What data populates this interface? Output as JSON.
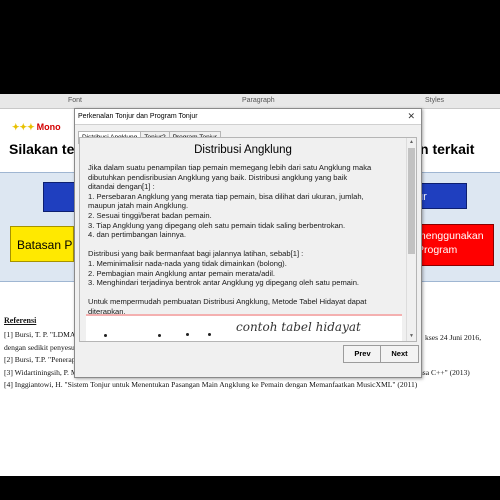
{
  "ribbon": {
    "groups": [
      "Font",
      "Paragraph",
      "Styles"
    ]
  },
  "document": {
    "logo_text": "Mono",
    "heading_left": "Silakan te",
    "heading_right": "n terkait",
    "btn_blue_right": "ur",
    "btn_yellow": "Batasan Pr",
    "btn_red_line1": "menggunakan",
    "btn_red_line2": "Program",
    "references": {
      "title": "Referensi",
      "items": [
        "[1] Bursi, T. P. \"LDMA",
        "dengan sedikit penyesu",
        "[2] Bursi, T.P. \"Penerap",
        "[3] Widartiningsih, P. M. \"Pendistribusian Angklung dan Komputasi Tonjur dengan Metode Pembagian Sesuai Beban menggunakan Bahasa C++\" (2013)",
        "[4] Inggiantowi, H. \"Sistem Tonjur untuk Menentukan Pasangan Main Angklung ke Pemain dengan Memanfaatkan MusicXML\" (2011)"
      ],
      "item1_tail": "kses 24 Juni 2016,"
    }
  },
  "dialog": {
    "title": "Perkenalan Tonjur dan Program Tonjur",
    "close_label": "✕",
    "tabs": [
      "Distribusi Angklung",
      "Tonjur?",
      "Program Tonjur"
    ],
    "active_tab": "Distribusi Angklung",
    "content": {
      "title": "Distribusi Angklung",
      "lines": [
        "Jika dalam suatu penampilan tiap pemain memegang lebih dari satu Angklung maka",
        "dibutuhkan pendisribusian Angklung yang baik. Distribusi angklung yang baik",
        "ditandai dengan[1] :",
        "1. Persebaran Angklung yang merata tiap pemain, bisa dilihat dari ukuran, jumlah,",
        "maupun jatah main Angklung.",
        "2. Sesuai tinggi/berat badan pemain.",
        "3. Tiap Angklung yang dipegang oleh satu pemain tidak saling berbentrokan.",
        "4. dan pertimbangan lainnya.",
        "",
        "Distribusi yang baik bermanfaat bagi jalannya latihan, sebab[1] :",
        "1. Meminimalisir nada-nada yang tidak dimainkan (bolong).",
        "2. Pembagian main Angklung antar pemain merata/adil.",
        "3. Menghindari terjadinya bentrok antar Angklung yg dipegang oleh satu pemain.",
        "",
        "Untuk mempermudah pembuatan Distribusi Angklung, Metode Tabel Hidayat dapat",
        "diterapkan."
      ],
      "image_caption": "contoh tabel hidayat"
    },
    "buttons": {
      "prev": "Prev",
      "next": "Next"
    }
  }
}
